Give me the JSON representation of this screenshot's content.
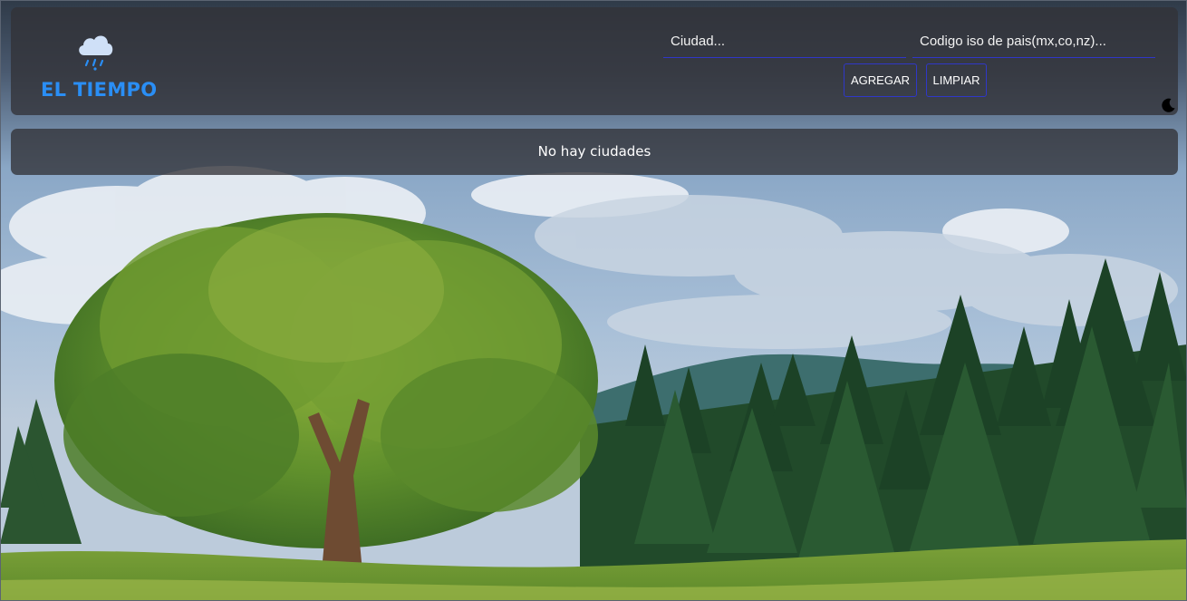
{
  "header": {
    "logo_text": "EL TIEMPO",
    "logo_icon": "cloud-rain-icon",
    "brand_color": "#2a8ef5",
    "accent_color": "#2f37c8"
  },
  "search": {
    "city_placeholder": "Ciudad...",
    "city_value": "",
    "country_placeholder": "Codigo iso de pais(mx,co,nz)...",
    "country_value": "",
    "add_label": "AGREGAR",
    "clear_label": "LIMPIAR"
  },
  "theme_toggle": {
    "icon": "moon-icon"
  },
  "results": {
    "empty_message": "No hay ciudades"
  },
  "background": {
    "description_icon": "landscape-background"
  }
}
